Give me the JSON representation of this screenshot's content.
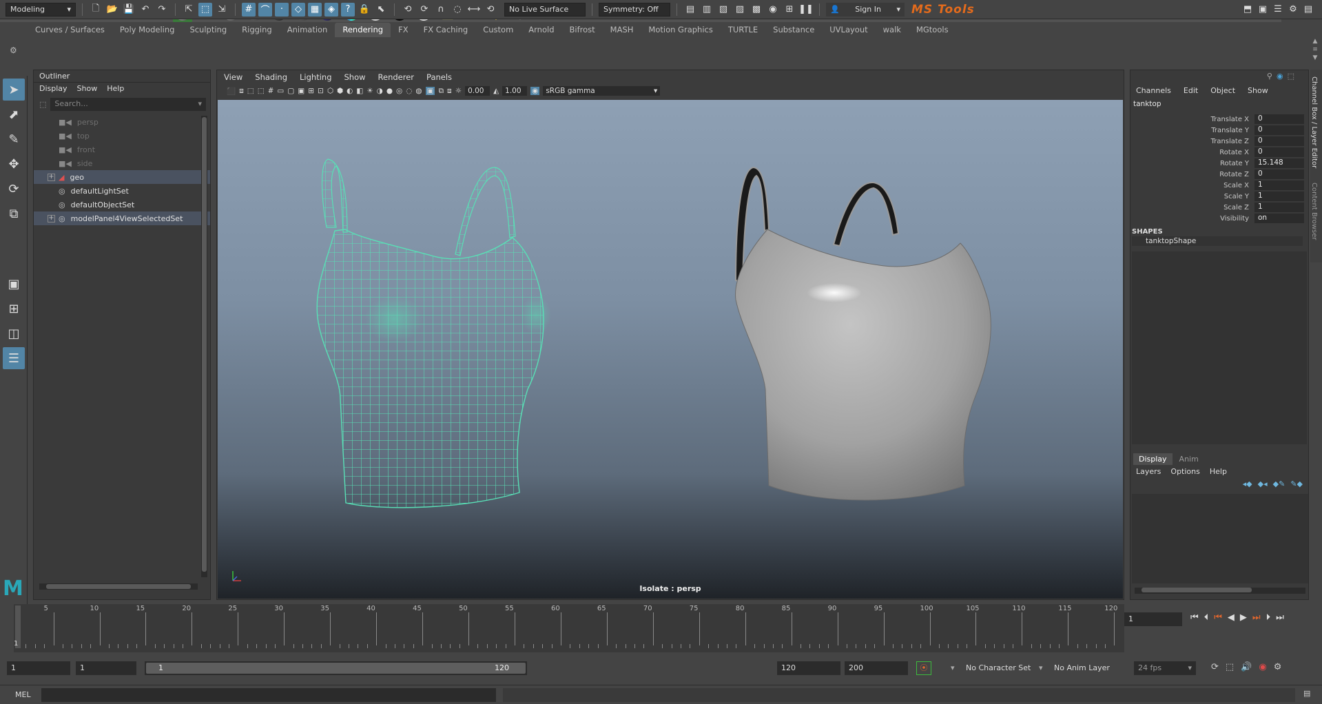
{
  "status": {
    "mode": "Modeling",
    "live_surface": "No Live Surface",
    "symmetry": "Symmetry: Off",
    "sign_in": "Sign In",
    "brand": "MS Tools"
  },
  "shelf_tabs": [
    "Curves / Surfaces",
    "Poly Modeling",
    "Sculpting",
    "Rigging",
    "Animation",
    "Rendering",
    "FX",
    "FX Caching",
    "Custom",
    "Arnold",
    "Bifrost",
    "MASH",
    "Motion Graphics",
    "TURTLE",
    "Substance",
    "UVLayout",
    "walk",
    "MGtools"
  ],
  "active_shelf_tab": "Rendering",
  "outliner": {
    "title": "Outliner",
    "menu": [
      "Display",
      "Show",
      "Help"
    ],
    "search_placeholder": "Search...",
    "items": [
      {
        "label": "persp",
        "dim": true
      },
      {
        "label": "top",
        "dim": true
      },
      {
        "label": "front",
        "dim": true
      },
      {
        "label": "side",
        "dim": true
      },
      {
        "label": "geo",
        "dim": false
      },
      {
        "label": "defaultLightSet",
        "dim": false
      },
      {
        "label": "defaultObjectSet",
        "dim": false
      },
      {
        "label": "modelPanel4ViewSelectedSet",
        "dim": false
      }
    ]
  },
  "viewport": {
    "menu": [
      "View",
      "Shading",
      "Lighting",
      "Show",
      "Renderer",
      "Panels"
    ],
    "exposure": "0.00",
    "gamma": "1.00",
    "color_space": "sRGB gamma",
    "isolate_label": "Isolate : persp"
  },
  "channel_box": {
    "menu": [
      "Channels",
      "Edit",
      "Object",
      "Show"
    ],
    "side_tab_1": "Channel Box / Layer Editor",
    "side_tab_2": "Content Browser",
    "object_name": "tanktop",
    "attributes": [
      {
        "name": "Translate X",
        "value": "0"
      },
      {
        "name": "Translate Y",
        "value": "0"
      },
      {
        "name": "Translate Z",
        "value": "0"
      },
      {
        "name": "Rotate X",
        "value": "0"
      },
      {
        "name": "Rotate Y",
        "value": "15.148"
      },
      {
        "name": "Rotate Z",
        "value": "0"
      },
      {
        "name": "Scale X",
        "value": "1"
      },
      {
        "name": "Scale Y",
        "value": "1"
      },
      {
        "name": "Scale Z",
        "value": "1"
      },
      {
        "name": "Visibility",
        "value": "on"
      }
    ],
    "shapes_label": "SHAPES",
    "shape_name": "tanktopShape"
  },
  "layer_editor": {
    "tabs": [
      "Display",
      "Anim"
    ],
    "menu": [
      "Layers",
      "Options",
      "Help"
    ]
  },
  "timeline": {
    "ticks": [
      "5",
      "10",
      "15",
      "20",
      "25",
      "30",
      "35",
      "40",
      "45",
      "50",
      "55",
      "60",
      "65",
      "70",
      "75",
      "80",
      "85",
      "90",
      "95",
      "100",
      "105",
      "110",
      "115",
      "120"
    ],
    "current_frame_marker": "1",
    "current_frame_field": "1"
  },
  "range": {
    "start_a": "1",
    "start_b": "1",
    "slider_start": "1",
    "slider_end": "120",
    "end_a": "120",
    "end_b": "200",
    "character_set": "No Character Set",
    "anim_layer": "No Anim Layer",
    "fps": "24 fps"
  },
  "command": {
    "language": "MEL"
  }
}
